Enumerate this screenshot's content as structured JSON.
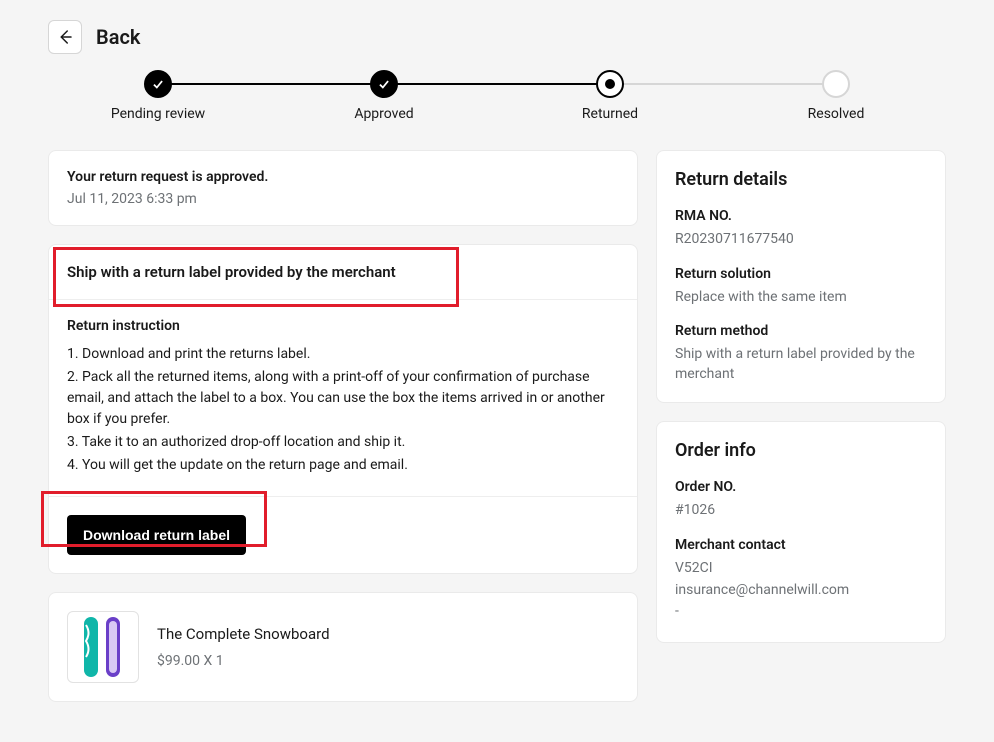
{
  "header": {
    "back_label": "Back"
  },
  "stepper": {
    "steps": [
      "Pending review",
      "Approved",
      "Returned",
      "Resolved"
    ],
    "done_index": 1,
    "current_index": 2
  },
  "status": {
    "title": "Your return request is approved.",
    "timestamp": "Jul 11, 2023 6:33 pm"
  },
  "shipping": {
    "header": "Ship with a return label provided by the merchant",
    "instruction_title": "Return instruction",
    "instructions": [
      "1. Download and print the returns label.",
      "2. Pack all the returned items, along with a print-off of your confirmation of purchase email, and attach the label to a box. You can use the box the items arrived in or another box if you prefer.",
      "3. Take it to an authorized drop-off location and ship it.",
      "4. You will get the update on the return page and email."
    ],
    "download_label": "Download return label"
  },
  "item": {
    "name": "The Complete Snowboard",
    "price_line": "$99.00 X 1"
  },
  "return_details": {
    "title": "Return details",
    "rma_label": "RMA NO.",
    "rma_value": "R20230711677540",
    "solution_label": "Return solution",
    "solution_value": "Replace with the same item",
    "method_label": "Return method",
    "method_value": "Ship with a return label provided by the merchant"
  },
  "order_info": {
    "title": "Order info",
    "order_no_label": "Order NO.",
    "order_no_value": "#1026",
    "contact_label": "Merchant contact",
    "contact_lines": [
      "V52CI",
      "insurance@channelwill.com",
      "-"
    ]
  }
}
